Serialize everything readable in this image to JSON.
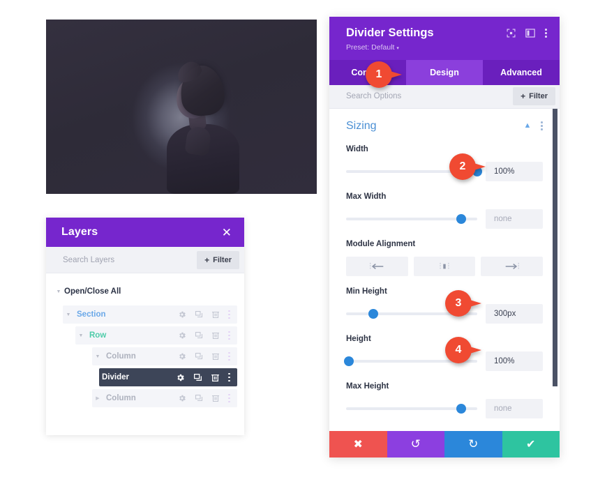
{
  "preview": {
    "name": "divider-module-preview",
    "alt": "Dark hero image with portrait of a person and radial glow"
  },
  "layers_panel": {
    "title": "Layers",
    "close_icon": "close-icon",
    "search_placeholder": "Search Layers",
    "filter_label": "Filter",
    "filter_plus": "+",
    "open_close_all": "Open/Close All",
    "row_icons": [
      "gear-icon",
      "duplicate-icon",
      "trash-icon",
      "kebab-icon"
    ],
    "rows": [
      {
        "label": "Section",
        "type": "section",
        "indent": 1,
        "expanded": true
      },
      {
        "label": "Row",
        "type": "row",
        "indent": 2,
        "expanded": true
      },
      {
        "label": "Column",
        "type": "column",
        "indent": 3,
        "expanded": true
      },
      {
        "label": "Divider",
        "type": "divider",
        "indent": 4,
        "expanded": false,
        "selected": true
      },
      {
        "label": "Column",
        "type": "column",
        "indent": 3,
        "expanded": false
      }
    ]
  },
  "settings_panel": {
    "title": "Divider Settings",
    "preset": "Preset: Default",
    "preset_caret": "▾",
    "header_icons": [
      "fullscreen-icon",
      "layout-icon",
      "kebab-icon"
    ],
    "tabs": [
      {
        "label": "Content",
        "active": false
      },
      {
        "label": "Design",
        "active": true
      },
      {
        "label": "Advanced",
        "active": false
      }
    ],
    "search_placeholder": "Search Options",
    "filter_label": "Filter",
    "filter_plus": "+",
    "section": {
      "title": "Sizing",
      "collapse_icon": "chevron-up-icon",
      "menu_icon": "kebab-icon"
    },
    "fields": [
      {
        "label": "Width",
        "value": "100%",
        "placeholder": false,
        "knob_pct": 100
      },
      {
        "label": "Max Width",
        "value": "none",
        "placeholder": true,
        "knob_pct": 88
      },
      {
        "label": "Module Alignment",
        "type": "align",
        "options": [
          "align-left-icon",
          "align-center-icon",
          "align-right-icon"
        ]
      },
      {
        "label": "Min Height",
        "value": "300px",
        "placeholder": false,
        "knob_pct": 21
      },
      {
        "label": "Height",
        "value": "100%",
        "placeholder": false,
        "knob_pct": 2
      },
      {
        "label": "Max Height",
        "value": "none",
        "placeholder": true,
        "knob_pct": 88
      }
    ],
    "footer": [
      {
        "name": "cancel",
        "icon": "✖",
        "color": "#ef5350"
      },
      {
        "name": "undo",
        "icon": "↺",
        "color": "#8c3fe0"
      },
      {
        "name": "redo",
        "icon": "↻",
        "color": "#2b87da"
      },
      {
        "name": "save",
        "icon": "✔",
        "color": "#2ec4a0"
      }
    ]
  },
  "callouts": [
    {
      "number": "1",
      "target": "design-tab"
    },
    {
      "number": "2",
      "target": "width-value"
    },
    {
      "number": "3",
      "target": "min-height-value"
    },
    {
      "number": "4",
      "target": "height-value"
    }
  ],
  "colors": {
    "purple_header": "#7626cd",
    "purple_tabbar": "#6a1fbd",
    "purple_tab_active": "#8b3fdc",
    "callout_red": "#f04a32",
    "slider_blue": "#2b87da",
    "section_title_blue": "#4a8fd4",
    "layer_section_blue": "#6aa8e8",
    "layer_row_green": "#4ecca9",
    "layer_selected_dark": "#3d4558"
  }
}
